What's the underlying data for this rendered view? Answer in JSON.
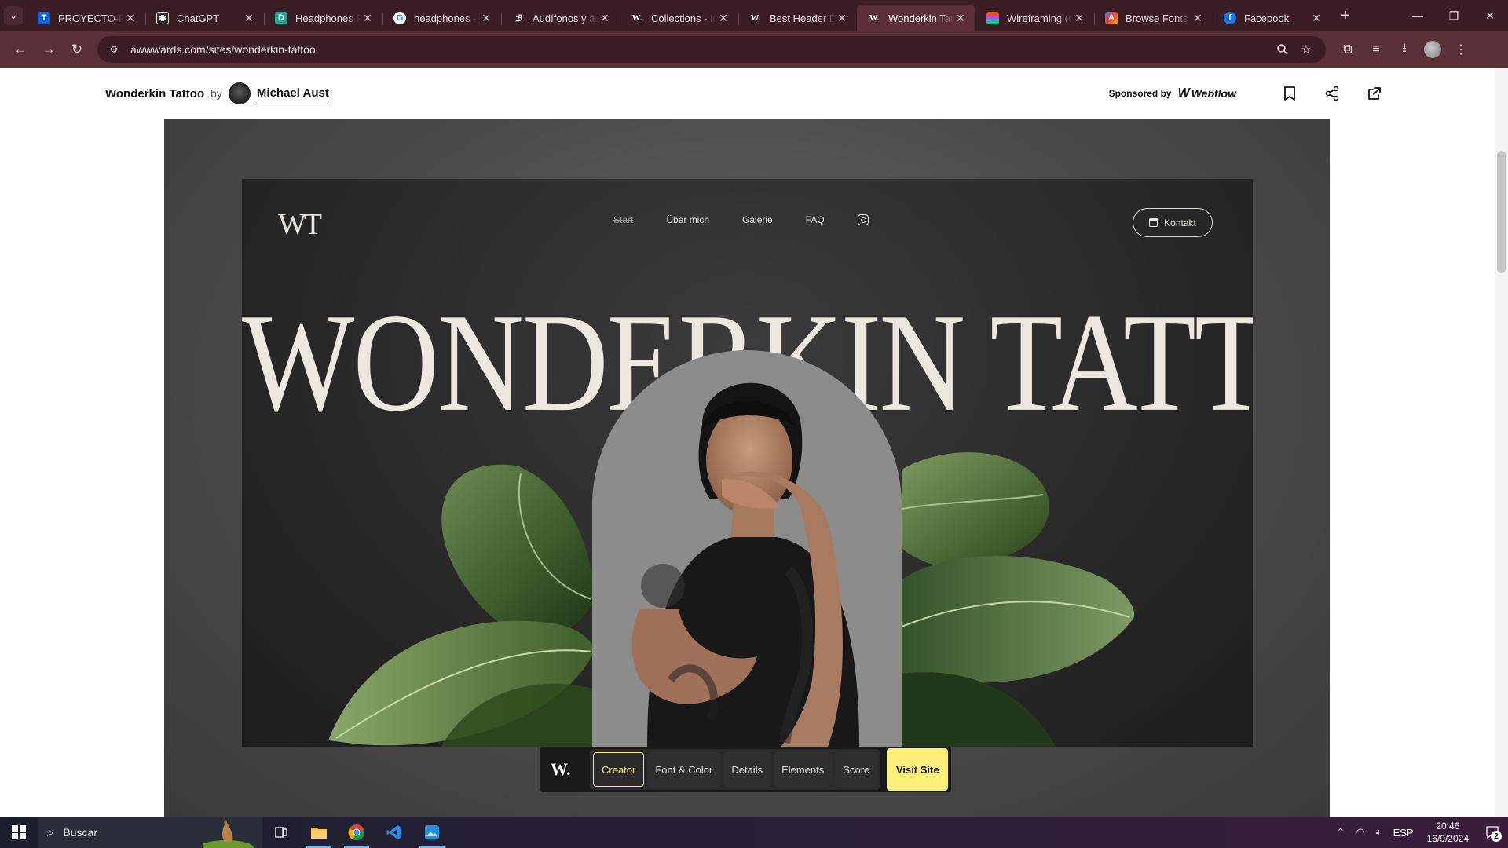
{
  "browser": {
    "tabs": [
      {
        "title": "PROYECTO-PO",
        "favicon": "trello-icon",
        "color": "#0c66e4",
        "glyph": "T"
      },
      {
        "title": "ChatGPT",
        "favicon": "openai-icon",
        "color": "#2b2b2b",
        "glyph": "✺"
      },
      {
        "title": "Headphones P",
        "favicon": "doc-icon",
        "color": "#25a69a",
        "glyph": "D"
      },
      {
        "title": "headphones - ",
        "favicon": "google-icon",
        "color": "#ffffff",
        "glyph": "G"
      },
      {
        "title": "Audífonos y au",
        "favicon": "bose-icon",
        "color": "#1f1f1f",
        "glyph": "B"
      },
      {
        "title": "Collections - In",
        "favicon": "awwwards-icon",
        "color": "#1f1f1f",
        "glyph": "W."
      },
      {
        "title": "Best Header De",
        "favicon": "awwwards-icon",
        "color": "#1f1f1f",
        "glyph": "W."
      },
      {
        "title": "Wonderkin Tatt",
        "favicon": "awwwards-icon",
        "color": "#1f1f1f",
        "glyph": "W.",
        "active": true
      },
      {
        "title": "Wireframing (C",
        "favicon": "figma-icon",
        "color": "#f24e1e",
        "glyph": "F"
      },
      {
        "title": "Browse Fonts - ",
        "favicon": "fonts-icon",
        "color": "#4285f4",
        "glyph": "A"
      },
      {
        "title": "Facebook",
        "favicon": "facebook-icon",
        "color": "#1877f2",
        "glyph": "f"
      }
    ],
    "url": "awwwards.com/sites/wonderkin-tattoo"
  },
  "page": {
    "site_title": "Wonderkin Tattoo",
    "by": "by",
    "author": "Michael Aust",
    "sponsored_by": "Sponsored by",
    "sponsor": "Webflow"
  },
  "site": {
    "logo": "WT",
    "nav": [
      "Start",
      "Über mich",
      "Galerie",
      "FAQ"
    ],
    "contact": "Kontakt",
    "hero": "WONDERKIN TATTOO"
  },
  "detail_bar": {
    "logo": "W.",
    "buttons": [
      "Creator",
      "Font & Color",
      "Details",
      "Elements",
      "Score"
    ],
    "visit": "Visit Site",
    "accent": "#fdf078"
  },
  "taskbar": {
    "search": "Buscar",
    "lang": "ESP",
    "time": "20:46",
    "date": "16/9/2024",
    "notifications": "2"
  }
}
